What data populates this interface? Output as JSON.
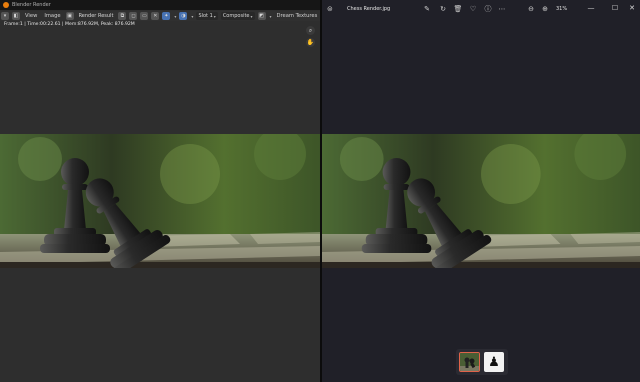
{
  "blender": {
    "window_title": "Blender Render",
    "menu": {
      "view": "View",
      "image": "Image"
    },
    "slot": "Render Result",
    "slot_number": "Slot 1",
    "pass": "Composite",
    "extra": "Dream Textures",
    "stats": "Frame:1 | Time:00:22.61 | Mem:876.92M, Peak: 876.92M"
  },
  "photos": {
    "file_name": "Chess Render.jpg",
    "zoom": "31%",
    "toolbar_icons": [
      "edit-icon",
      "rotate-icon",
      "delete-icon",
      "favorite-icon",
      "info-icon",
      "more-icon"
    ],
    "window_controls": [
      "minimize",
      "maximize",
      "close"
    ],
    "filmstrip": [
      "Chess Render",
      "Pawn"
    ]
  },
  "colors": {
    "blender_accent": "#4772b3",
    "blender_logo": "#e87d0d",
    "thumb_border": "#e0634a"
  }
}
